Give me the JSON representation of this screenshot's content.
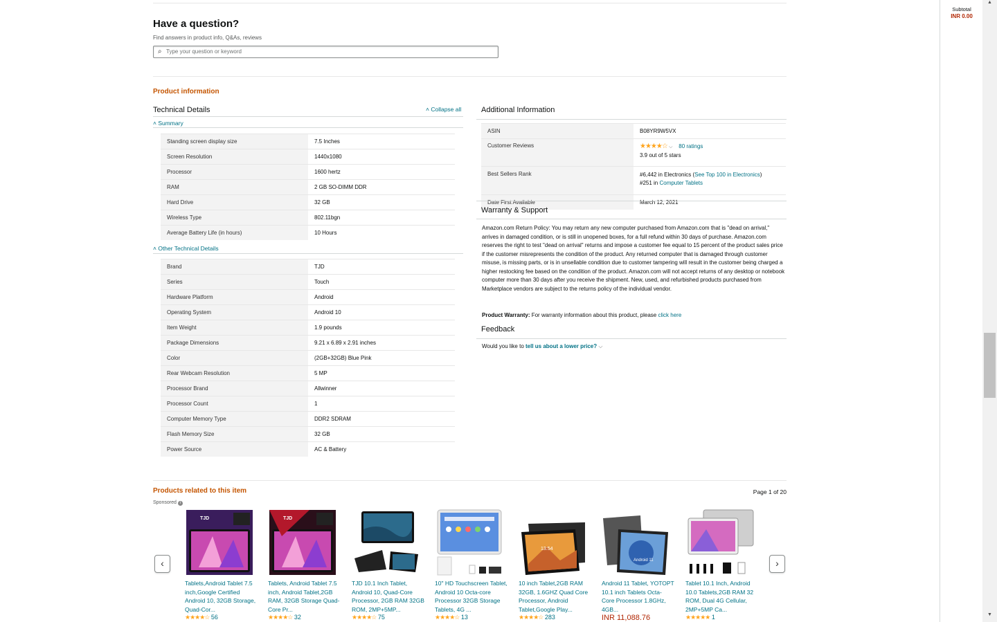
{
  "question": {
    "title": "Have a question?",
    "subtitle": "Find answers in product info, Q&As, reviews",
    "placeholder": "Type your question or keyword"
  },
  "product_info": {
    "heading": "Product information",
    "technical_details": "Technical Details",
    "collapse_all": "Collapse all",
    "summary": "Summary",
    "other_technical": "Other Technical Details",
    "summary_rows": [
      {
        "k": "Standing screen display size",
        "v": "7.5 Inches"
      },
      {
        "k": "Screen Resolution",
        "v": "1440x1080"
      },
      {
        "k": "Processor",
        "v": "1600 hertz"
      },
      {
        "k": "RAM",
        "v": "2 GB SO-DIMM DDR"
      },
      {
        "k": "Hard Drive",
        "v": "32 GB"
      },
      {
        "k": "Wireless Type",
        "v": "802.11bgn"
      },
      {
        "k": "Average Battery Life (in hours)",
        "v": "10 Hours"
      }
    ],
    "other_rows": [
      {
        "k": "Brand",
        "v": "TJD"
      },
      {
        "k": "Series",
        "v": "Touch"
      },
      {
        "k": "Hardware Platform",
        "v": "Android"
      },
      {
        "k": "Operating System",
        "v": "Android 10"
      },
      {
        "k": "Item Weight",
        "v": "1.9 pounds"
      },
      {
        "k": "Package Dimensions",
        "v": "9.21 x 6.89 x 2.91 inches"
      },
      {
        "k": "Color",
        "v": "(2GB+32GB) Blue Pink"
      },
      {
        "k": "Rear Webcam Resolution",
        "v": "5 MP"
      },
      {
        "k": "Processor Brand",
        "v": "Allwinner"
      },
      {
        "k": "Processor Count",
        "v": "1"
      },
      {
        "k": "Computer Memory Type",
        "v": "DDR2 SDRAM"
      },
      {
        "k": "Flash Memory Size",
        "v": "32 GB"
      },
      {
        "k": "Power Source",
        "v": "AC & Battery"
      }
    ]
  },
  "additional": {
    "heading": "Additional Information",
    "asin_label": "ASIN",
    "asin": "B08YR9W5VX",
    "reviews_label": "Customer Reviews",
    "stars": "★★★★☆",
    "ratings": "80 ratings",
    "out_of": "3.9 out of 5 stars",
    "bsr_label": "Best Sellers Rank",
    "bsr1_prefix": "#6,442 in Electronics (",
    "bsr1_link": "See Top 100 in Electronics",
    "bsr1_suffix": ")",
    "bsr2_prefix": "#251 in ",
    "bsr2_link": "Computer Tablets",
    "date_label": "Date First Available",
    "date": "March 12, 2021"
  },
  "warranty": {
    "heading": "Warranty & Support",
    "policy": "Amazon.com Return Policy: You may return any new computer purchased from Amazon.com that is \"dead on arrival,\" arrives in damaged condition, or is still in unopened boxes, for a full refund within 30 days of purchase. Amazon.com reserves the right to test \"dead on arrival\" returns and impose a customer fee equal to 15 percent of the product sales price if the customer misrepresents the condition of the product. Any returned computer that is damaged through customer misuse, is missing parts, or is in unsellable condition due to customer tampering will result in the customer being charged a higher restocking fee based on the condition of the product. Amazon.com will not accept returns of any desktop or notebook computer more than 30 days after you receive the shipment. New, used, and refurbished products purchased from Marketplace vendors are subject to the returns policy of the individual vendor.",
    "warranty_label": "Product Warranty:",
    "warranty_text": " For warranty information about this product, please ",
    "warranty_link": "click here"
  },
  "feedback": {
    "heading": "Feedback",
    "prefix": "Would you like to ",
    "link": "tell us about a lower price?"
  },
  "related": {
    "heading": "Products related to this item",
    "page": "Page 1 of 20",
    "sponsored": "Sponsored",
    "items": [
      {
        "title": "Tablets,Android Tablet 7.5 inch,Google Certified Android 10, 32GB Storage, Quad-Cor...",
        "stars": "★★★★☆",
        "count": "56"
      },
      {
        "title": "Tablets, Android Tablet 7.5 inch, Android Tablet,2GB RAM, 32GB Storage Quad-Core Pr...",
        "stars": "★★★★☆",
        "count": "32"
      },
      {
        "title": "TJD 10.1 Inch Tablet, Android 10, Quad-Core Processor, 2GB RAM 32GB ROM, 2MP+5MP...",
        "stars": "★★★★☆",
        "count": "75"
      },
      {
        "title": "10\" HD Touchscreen Tablet, Android 10 Octa-core Processor 32GB Storage Tablets, 4G ...",
        "stars": "★★★★☆",
        "count": "13"
      },
      {
        "title": "10 inch Tablet,2GB RAM 32GB, 1.6GHZ Quad Core Processor, Android Tablet,Google Play...",
        "stars": "★★★★☆",
        "count": "283"
      },
      {
        "title": "Android 11 Tablet, YOTOPT 10.1 inch Tablets Octa-Core Processor 1.8GHz, 4GB...",
        "price": "INR 11,088.76"
      },
      {
        "title": "Tablet 10.1 Inch, Android 10.0 Tablets,2GB RAM 32 ROM, Dual 4G Cellular, 2MP+5MP Ca...",
        "stars": "★★★★★",
        "count": "1"
      }
    ]
  },
  "cart": {
    "subtotal_label": "Subtotal",
    "subtotal": "INR 0.00"
  }
}
